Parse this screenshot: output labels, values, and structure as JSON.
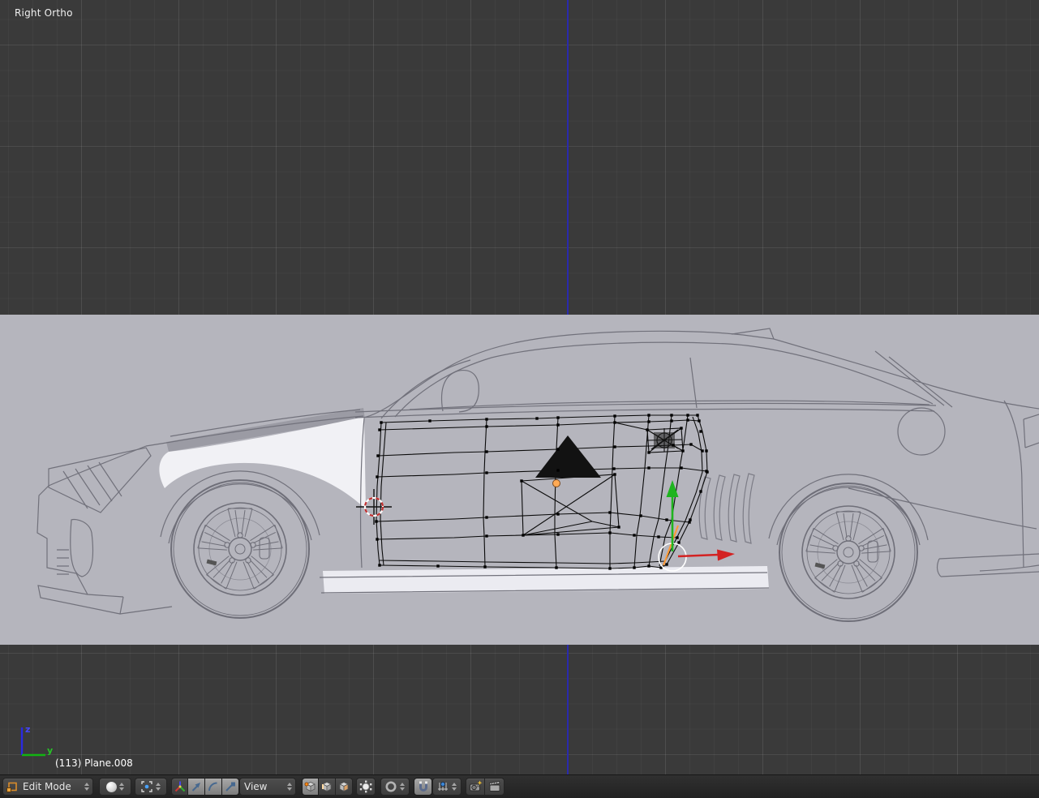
{
  "viewport": {
    "view_label": "Right Ortho",
    "object_info": "(113) Plane.008",
    "axis_gizmo": {
      "vertical_label": "z",
      "horizontal_label": "y",
      "z_color": "#2a2ae0",
      "y_color": "#12b412"
    },
    "grid": {
      "background": "#3a3a3a",
      "axis_line_color": "#2a2aac"
    },
    "reference_band_color": "#b5b5bd"
  },
  "scene": {
    "reference_image": "camaro-zl1-side-view-blueprint",
    "edit_mesh": "car-door-wireframe",
    "manipulator": {
      "orientation": "View",
      "x_arrow_color": "#d32222",
      "y_arrow_color": "#1fb41f"
    },
    "cursor_colors": {
      "ring_red": "#c23030",
      "ring_white": "#ffffff"
    },
    "origin_dot_color": "#ffaa55",
    "selected_edge_color": "#ff9933"
  },
  "header": {
    "mode_dropdown": {
      "label": "Edit Mode",
      "icon": "edit-mode-cube-icon"
    },
    "shading_dropdown": {
      "icon": "viewport-shading-sphere-icon"
    },
    "pivot_dropdown": {
      "icon": "pivot-point-icon"
    },
    "manipulator_buttons": {
      "axes": {
        "icon": "manipulator-axes-icon",
        "pressed": false
      },
      "translate": {
        "icon": "translate-manipulator-icon",
        "pressed": true
      },
      "rotate": {
        "icon": "rotate-manipulator-icon",
        "pressed": true
      },
      "scale": {
        "icon": "scale-manipulator-icon",
        "pressed": true
      }
    },
    "orientation_dropdown": {
      "label": "View"
    },
    "select_mode_buttons": {
      "vertex": {
        "icon": "vertex-select-icon",
        "pressed": true
      },
      "edge": {
        "icon": "edge-select-icon",
        "pressed": false
      },
      "face": {
        "icon": "face-select-icon",
        "pressed": false
      }
    },
    "occlude_button": {
      "icon": "occlude-geometry-icon",
      "pressed": false
    },
    "proportional_dropdown": {
      "icon": "proportional-editing-icon"
    },
    "snap_button": {
      "icon": "snap-magnet-icon",
      "pressed": true
    },
    "snap_element_dropdown": {
      "icon": "snap-increment-icon"
    },
    "render_buttons": {
      "still": {
        "icon": "opengl-render-icon"
      },
      "animation": {
        "icon": "opengl-render-animation-icon"
      }
    }
  }
}
